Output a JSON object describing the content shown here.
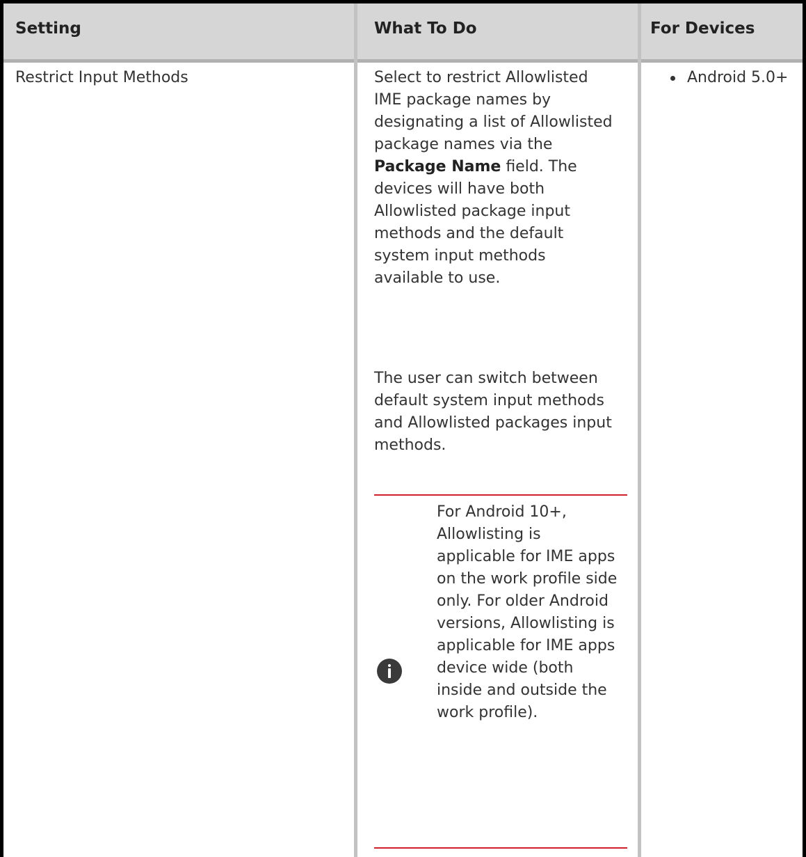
{
  "table": {
    "headers": {
      "setting": "Setting",
      "what_to_do": "What To Do",
      "for_devices": "For Devices"
    },
    "row": {
      "setting_name": "Restrict Input Methods",
      "what_to_do": {
        "para1_before": "Select to restrict Allowlisted IME package names by designating a list of Allowlisted package names via the ",
        "para1_bold": "Package Name",
        "para1_after": " field. The devices will have both Allowlisted package input methods and the default system input methods available to use.",
        "para2": "The user can switch between default system input methods and Allowlisted packages input methods.",
        "note": "For Android 10+, Allowlisting is applicable for IME apps on the work profile side only. For older Android versions, Allowlisting is applicable for IME apps device wide (both inside and outside the work profile)."
      },
      "devices": [
        "Android 5.0+"
      ]
    }
  },
  "icons": {
    "note_icon": "info-icon"
  },
  "colors": {
    "header_bg": "#d6d6d6",
    "note_rule": "#d0202a",
    "icon_bg": "#3a3a3a"
  }
}
